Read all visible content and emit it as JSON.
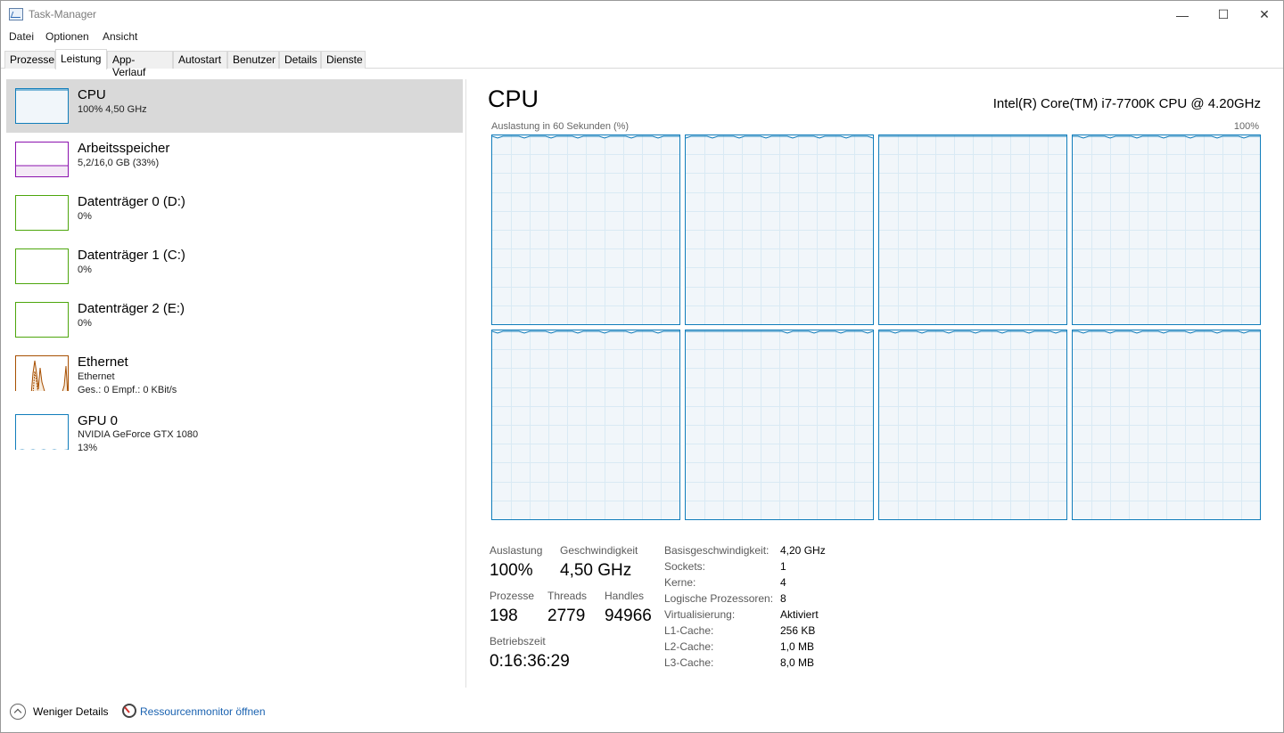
{
  "window": {
    "title": "Task-Manager"
  },
  "menu": [
    "Datei",
    "Optionen",
    "Ansicht"
  ],
  "tabs": [
    "Prozesse",
    "Leistung",
    "App-Verlauf",
    "Autostart",
    "Benutzer",
    "Details",
    "Dienste"
  ],
  "active_tab": "Leistung",
  "resources": [
    {
      "name": "CPU",
      "line1": "100%  4,50 GHz",
      "color": "#117dbb",
      "utilization": 1.0
    },
    {
      "name": "Arbeitsspeicher",
      "line1": "5,2/16,0 GB (33%)",
      "color": "#8b12ae",
      "utilization": 0.33
    },
    {
      "name": "Datenträger 0 (D:)",
      "line1": "0%",
      "color": "#4da60c",
      "utilization": 0.0
    },
    {
      "name": "Datenträger 1 (C:)",
      "line1": "0%",
      "color": "#4da60c",
      "utilization": 0.0
    },
    {
      "name": "Datenträger 2 (E:)",
      "line1": "0%",
      "color": "#4da60c",
      "utilization": 0.0
    },
    {
      "name": "Ethernet",
      "line1": "Ethernet",
      "line2": "Ges.: 0 Empf.: 0 KBit/s",
      "color": "#a74f01"
    },
    {
      "name": "GPU 0",
      "line1": "NVIDIA GeForce GTX 1080",
      "line2": "13%",
      "color": "#117dbb",
      "utilization": 0.13
    }
  ],
  "detail": {
    "heading": "CPU",
    "model": "Intel(R) Core(TM) i7-7700K CPU @ 4.20GHz",
    "graph_caption": "Auslastung in 60 Sekunden (%)",
    "graph_max": "100%",
    "logical_processor_graphs": 8,
    "stats": {
      "auslastung_label": "Auslastung",
      "auslastung": "100%",
      "geschwindigkeit_label": "Geschwindigkeit",
      "geschwindigkeit": "4,50 GHz",
      "prozesse_label": "Prozesse",
      "prozesse": "198",
      "threads_label": "Threads",
      "threads": "2779",
      "handles_label": "Handles",
      "handles": "94966",
      "betriebszeit_label": "Betriebszeit",
      "betriebszeit": "0:16:36:29"
    },
    "specs": [
      {
        "label": "Basisgeschwindigkeit:",
        "value": "4,20 GHz"
      },
      {
        "label": "Sockets:",
        "value": "1"
      },
      {
        "label": "Kerne:",
        "value": "4"
      },
      {
        "label": "Logische Prozessoren:",
        "value": "8"
      },
      {
        "label": "Virtualisierung:",
        "value": "Aktiviert"
      },
      {
        "label": "L1-Cache:",
        "value": "256 KB"
      },
      {
        "label": "L2-Cache:",
        "value": "1,0 MB"
      },
      {
        "label": "L3-Cache:",
        "value": "8,0 MB"
      }
    ]
  },
  "footer": {
    "fewer_details": "Weniger Details",
    "resource_monitor": "Ressourcenmonitor öffnen"
  }
}
